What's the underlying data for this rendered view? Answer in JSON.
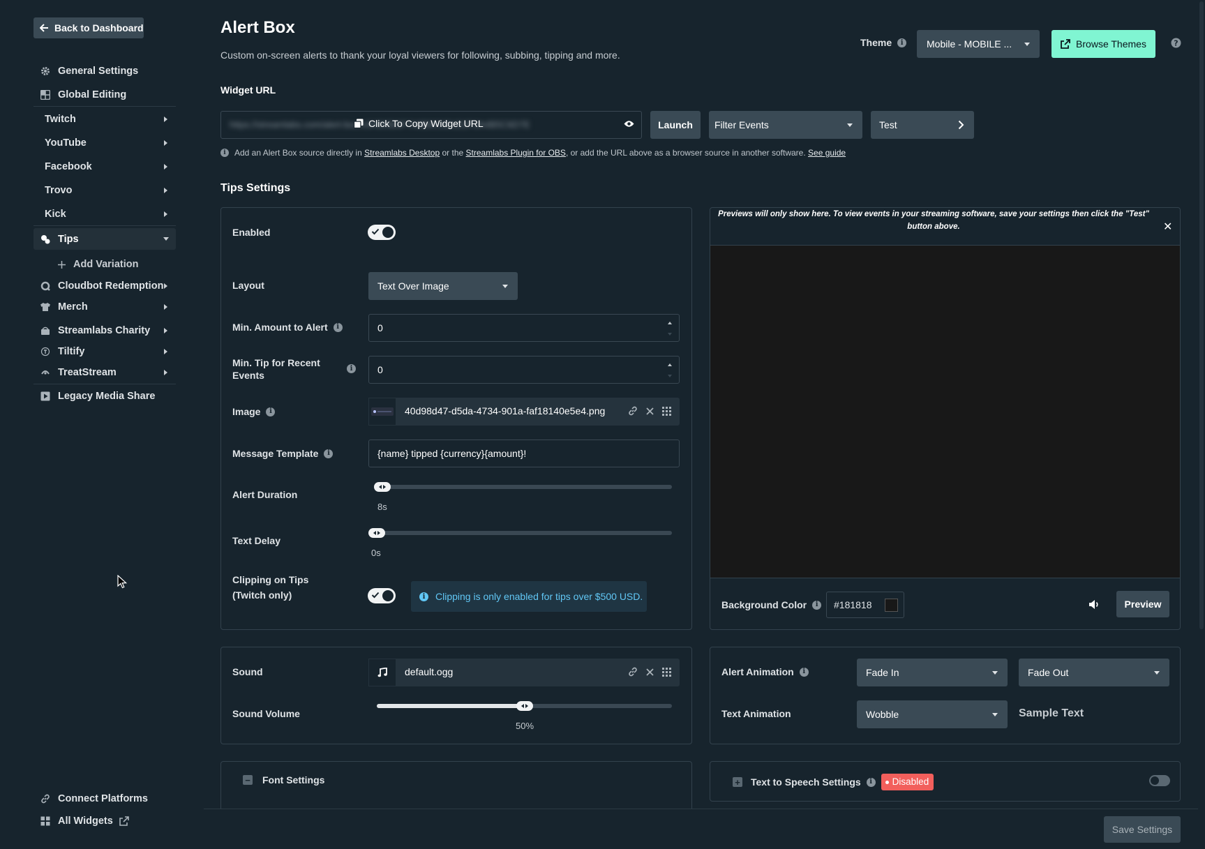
{
  "sidebar": {
    "back_label": "Back to Dashboard",
    "general_settings": "General Settings",
    "global_editing": "Global Editing",
    "platforms": [
      "Twitch",
      "YouTube",
      "Facebook",
      "Trovo",
      "Kick"
    ],
    "tips": "Tips",
    "add_variation": "Add Variation",
    "integrations": [
      "Cloudbot Redemption",
      "Merch",
      "Streamlabs Charity",
      "Tiltify",
      "TreatStream"
    ],
    "legacy_media_share": "Legacy Media Share",
    "connect_platforms": "Connect Platforms",
    "all_widgets": "All Widgets"
  },
  "header": {
    "title": "Alert Box",
    "subtitle": "Custom on-screen alerts to thank your loyal viewers for following, subbing, tipping and more.",
    "theme_label": "Theme",
    "theme_value": "Mobile - MOBILE ...",
    "browse_themes": "Browse Themes"
  },
  "widget_url": {
    "label": "Widget URL",
    "masked_url": "https://streamlabs.com/alert-box/v3/4D5E6F7A8B9C0D1E2F3A4B5C6D7E",
    "copy_label": "Click To Copy Widget URL",
    "launch": "Launch",
    "filter_events": "Filter Events",
    "test": "Test",
    "hint_1": "Add an Alert Box source directly in",
    "hint_link_1": "Streamlabs Desktop",
    "hint_2": "or the",
    "hint_link_2": "Streamlabs Plugin for OBS",
    "hint_3": ", or add the URL above as a browser source in another software.",
    "hint_link_3": "See guide"
  },
  "tips_settings": {
    "title": "Tips Settings",
    "enabled_label": "Enabled",
    "layout_label": "Layout",
    "layout_value": "Text Over Image",
    "min_amount_label": "Min. Amount to Alert",
    "min_amount_value": "0",
    "min_tip_label_1": "Min. Tip for Recent",
    "min_tip_label_2": "Events",
    "min_tip_value": "0",
    "image_label": "Image",
    "image_file": "40d98d47-d5da-4734-901a-faf18140e5e4.png",
    "message_template_label": "Message Template",
    "message_template_value": "{name} tipped {currency}{amount}!",
    "alert_duration_label": "Alert Duration",
    "alert_duration_value": "8s",
    "text_delay_label": "Text Delay",
    "text_delay_value": "0s",
    "clipping_label_1": "Clipping on Tips",
    "clipping_label_2": "(Twitch only)",
    "clipping_note": "Clipping is only enabled for tips over $500 USD."
  },
  "preview": {
    "note": "Previews will only show here. To view events in your streaming software, save your settings then click the \"Test\" button above.",
    "background_label": "Background Color",
    "background_value": "#181818",
    "preview_btn": "Preview"
  },
  "sound": {
    "sound_label": "Sound",
    "sound_file": "default.ogg",
    "volume_label": "Sound Volume",
    "volume_value": "50%",
    "volume_fraction": 0.5
  },
  "animation": {
    "alert_animation_label": "Alert Animation",
    "alert_in": "Fade In",
    "alert_out": "Fade Out",
    "text_animation_label": "Text Animation",
    "text_animation_value": "Wobble",
    "sample_text": "Sample Text"
  },
  "font_settings": {
    "title": "Font Settings"
  },
  "tts": {
    "title": "Text to Speech Settings",
    "status": "Disabled"
  },
  "footer": {
    "save": "Save Settings"
  },
  "colors": {
    "background": "#17242d",
    "accent": "#80f5d2",
    "button": "#3a4a55",
    "info_blue": "#61c7f5",
    "danger": "#f25f5c"
  }
}
